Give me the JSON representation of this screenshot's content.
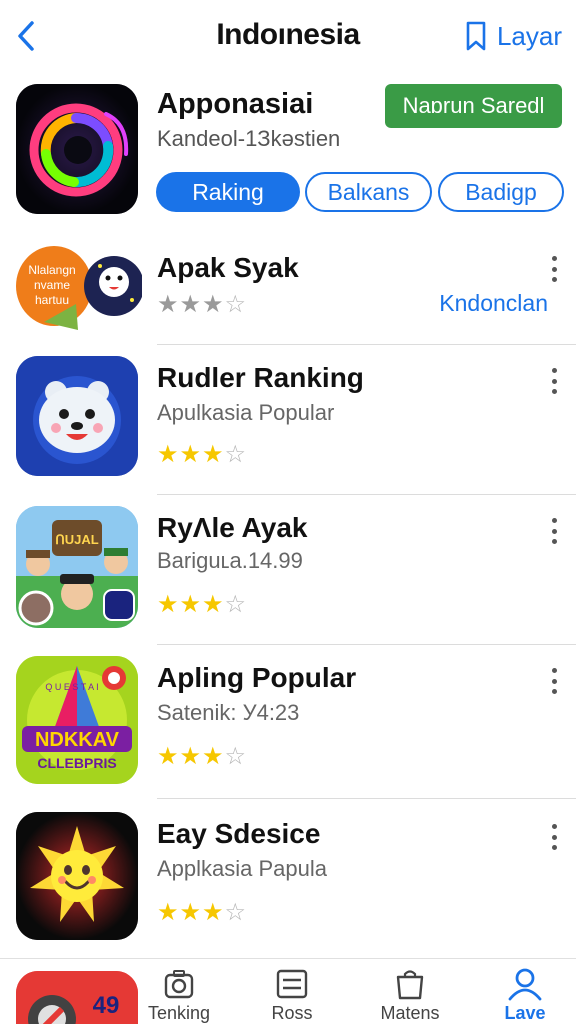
{
  "header": {
    "title": "Indoınesia",
    "back_icon": "chevron-left-icon",
    "action_icon": "bookmark-icon",
    "action_label": "Layar",
    "accent": "#1a73e8"
  },
  "featured": {
    "name": "Apponasiai",
    "subtitle": "Kandeol-1Зkəstien",
    "install_label": "Naɒrun Saredl",
    "install_color": "#3a9b46",
    "chips": [
      {
        "label": "Raking",
        "active": true
      },
      {
        "label": "Balĸans",
        "active": false
      },
      {
        "label": "Badigp",
        "active": false
      }
    ]
  },
  "apps": [
    {
      "name": "Apak Syak",
      "subtitle": "",
      "rating": 3,
      "rating_max": 5,
      "star_color": "gray",
      "action_label": "Kndonclan"
    },
    {
      "name": "Rudler Ranking",
      "subtitle": "Apulkasia Popular",
      "rating": 3,
      "rating_max": 5,
      "star_color": "yellow"
    },
    {
      "name": "RyΛle Ayak",
      "subtitle": "Bariguʟa.14.99",
      "rating": 3,
      "rating_max": 5,
      "star_color": "yellow"
    },
    {
      "name": "Apling Popular",
      "subtitle": "Satenik: У4:23",
      "rating": 3,
      "rating_max": 5,
      "star_color": "yellow"
    },
    {
      "name": "Eay Sdesice",
      "subtitle": "Applkasia Papula",
      "rating": 3,
      "rating_max": 5,
      "star_color": "yellow"
    }
  ],
  "icon_text": {
    "app1": [
      "Nlalangn",
      "nvame",
      "hartuu"
    ],
    "app3": "ᑎUJAL",
    "app4_top": "Q U E S T A I",
    "app4_main": "NDKKAV",
    "app4_sub": "CLLEBPRIS",
    "peek": "49"
  },
  "bottom_nav": [
    {
      "label": "Tenking",
      "icon": "camera-icon",
      "active": false
    },
    {
      "label": "Ross",
      "icon": "list-icon",
      "active": false
    },
    {
      "label": "Matens",
      "icon": "shopping-bag-icon",
      "active": false
    },
    {
      "label": "Lave",
      "icon": "person-icon",
      "active": true
    }
  ]
}
